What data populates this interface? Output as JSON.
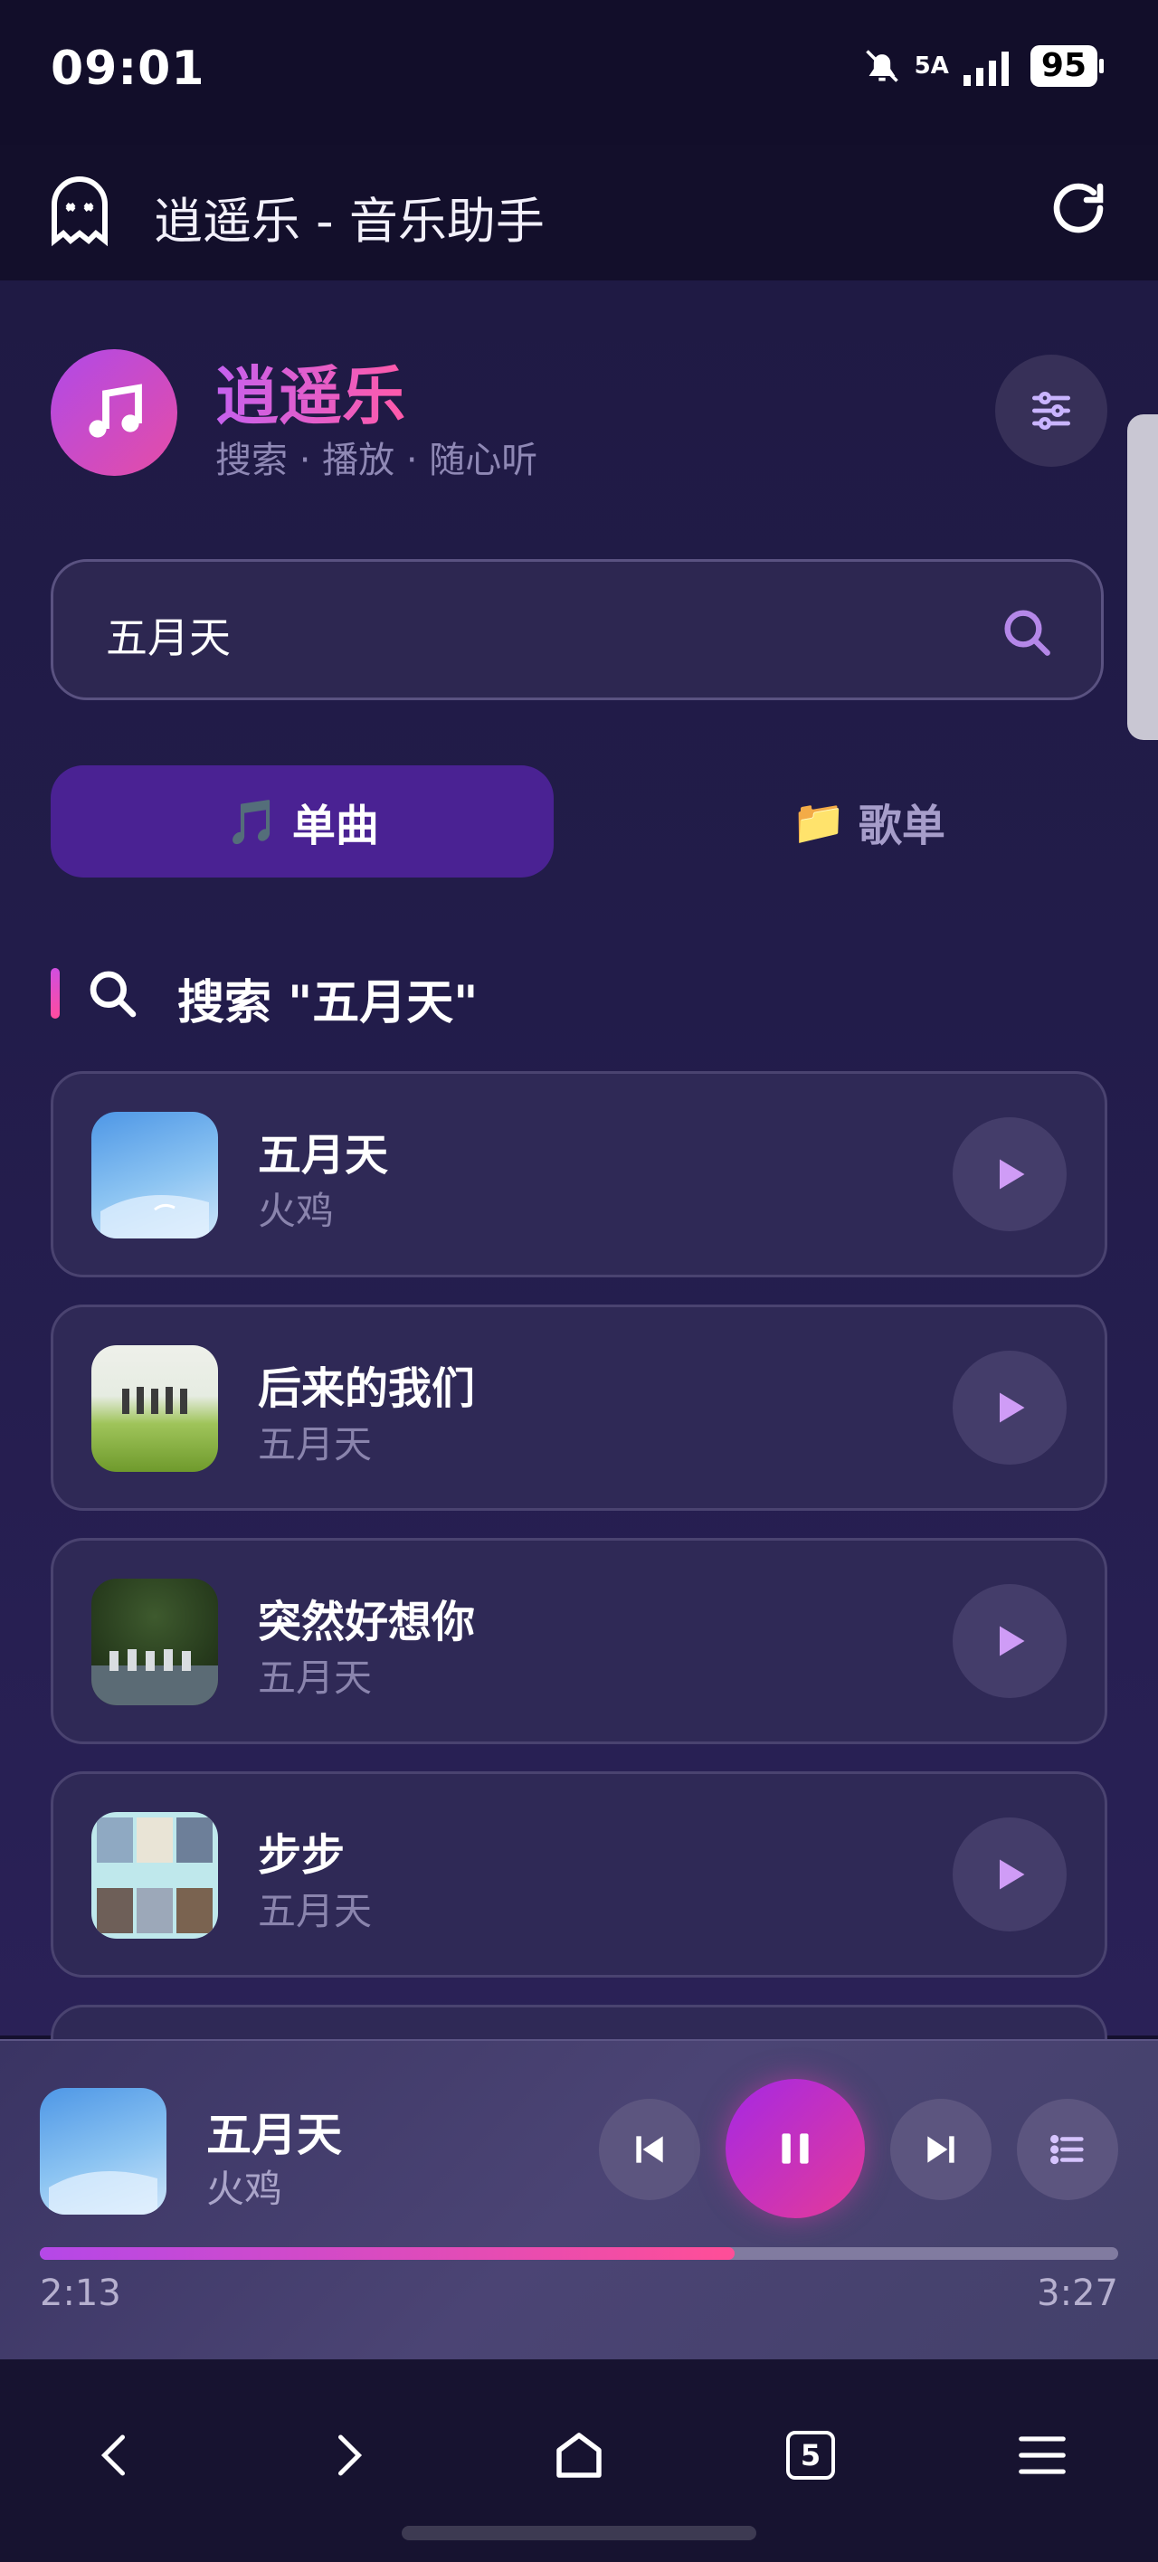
{
  "status_bar": {
    "time": "09:01",
    "network": "5A",
    "battery": "95"
  },
  "app_bar": {
    "title": "逍遥乐 - 音乐助手"
  },
  "header": {
    "brand": "逍遥乐",
    "tagline": "搜索 · 播放 · 随心听"
  },
  "search": {
    "value": "五月天"
  },
  "tabs": [
    {
      "label": "单曲",
      "active": true
    },
    {
      "label": "歌单",
      "active": false
    }
  ],
  "results": {
    "heading": "搜索 \"五月天\"",
    "songs": [
      {
        "title": "五月天",
        "artist": "火鸡"
      },
      {
        "title": "后来的我们",
        "artist": "五月天"
      },
      {
        "title": "突然好想你",
        "artist": "五月天"
      },
      {
        "title": "步步",
        "artist": "五月天"
      }
    ]
  },
  "player": {
    "title": "五月天",
    "artist": "火鸡",
    "current_time": "2:13",
    "total_time": "3:27",
    "progress": 0.644
  },
  "nav": {
    "tab_count": "5"
  },
  "colors": {
    "accent_start": "#b548e8",
    "accent_end": "#ff4e97",
    "tab_active": "#4a2293"
  }
}
